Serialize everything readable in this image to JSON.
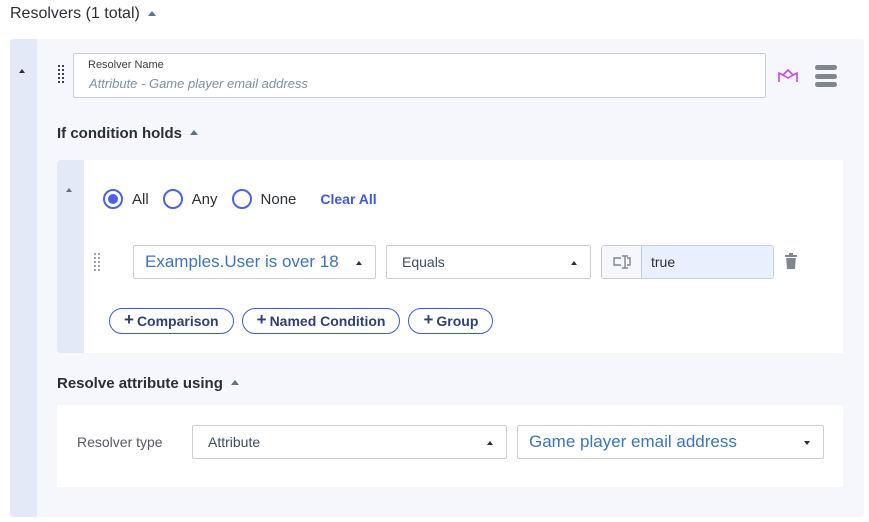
{
  "header": {
    "title": "Resolvers (1 total)",
    "collapse_icon": "caret-up-icon"
  },
  "resolver": {
    "name_label": "Resolver Name",
    "name_value": "Attribute - Game player email address",
    "icons": {
      "drag": "drag-handle-icon",
      "crown": "crown-icon",
      "menu": "hamburger-menu-icon"
    },
    "colors": {
      "crown": "#cc44ee",
      "accent": "#4a63e8",
      "rail": "#e3e9f6",
      "card_bg": "#f5f7fc"
    }
  },
  "condition": {
    "title": "If condition holds",
    "match_options": [
      {
        "label": "All",
        "checked": true
      },
      {
        "label": "Any",
        "checked": false
      },
      {
        "label": "None",
        "checked": false
      }
    ],
    "clear_all": "Clear All",
    "row": {
      "field": "Examples.User is over 18",
      "operator": "Equals",
      "value": "true",
      "value_type_icon": "text-cursor-icon",
      "delete_icon": "trash-icon"
    },
    "add_buttons": [
      {
        "label": "Comparison"
      },
      {
        "label": "Named Condition"
      },
      {
        "label": "Group"
      }
    ]
  },
  "resolve": {
    "title": "Resolve attribute using",
    "type_label": "Resolver type",
    "type_value": "Attribute",
    "attribute_value": "Game player email address"
  }
}
